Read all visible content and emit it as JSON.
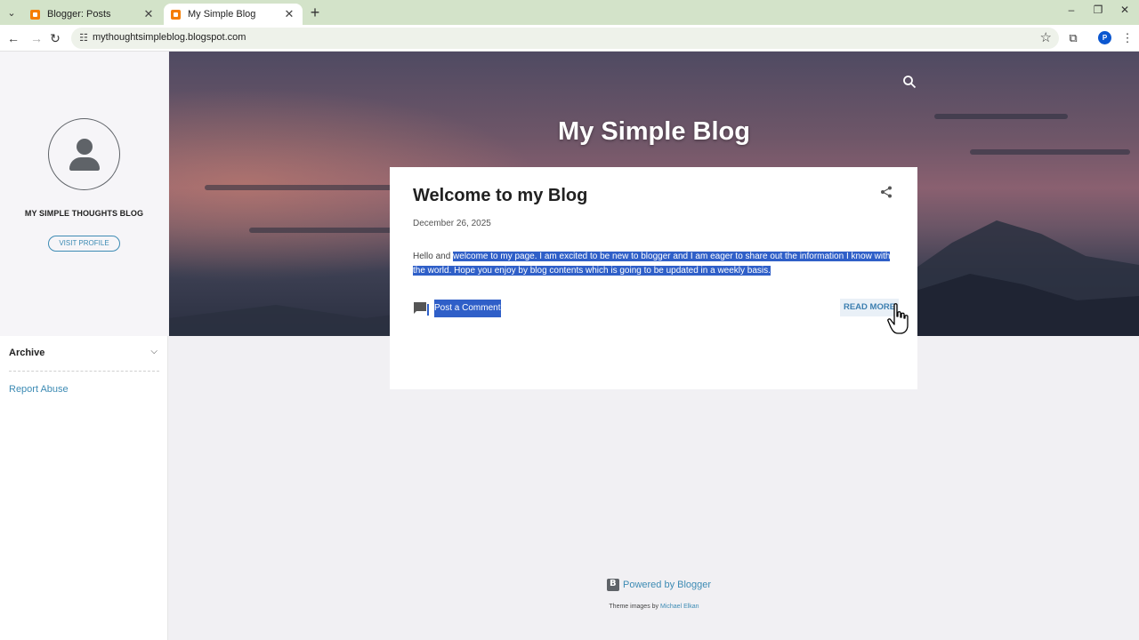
{
  "browser": {
    "tabs": [
      {
        "title": "Blogger: Posts",
        "active": false
      },
      {
        "title": "My Simple Blog",
        "active": true
      }
    ],
    "url": "mythoughtsimpleblog.blogspot.com",
    "profile_initial": "P"
  },
  "sidebar": {
    "blog_name": "MY SIMPLE THOUGHTS BLOG",
    "visit_profile": "VISIT PROFILE",
    "archive": "Archive",
    "report_abuse": "Report Abuse"
  },
  "header": {
    "title": "My Simple Blog"
  },
  "post": {
    "title": "Welcome to my Blog",
    "date": "December 26, 2025",
    "body_unselected": "Hello and ",
    "body_selected_1": "welcome to my page. I am excited to be new to blogger and I am eager to share out the information I know with",
    "body_selected_2": "the world. Hope you enjoy by blog contents which is going to be updated in a weekly basis.",
    "comment_link": "Post a Comment",
    "read_more": "READ MORE"
  },
  "footer": {
    "powered_by": "Powered by Blogger",
    "theme_prefix": "Theme images by ",
    "theme_author": "Michael Elkan"
  },
  "colors": {
    "selection": "#2f5fc8",
    "link": "#3d8bb4",
    "tabstrip": "#d3e3c9"
  }
}
